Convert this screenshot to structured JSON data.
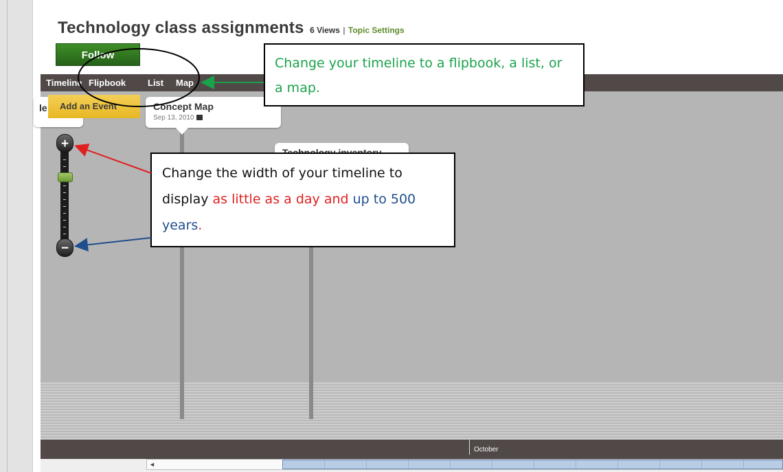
{
  "page": {
    "title": "Technology class assignments",
    "views": "6 Views",
    "separator": "|",
    "topic_settings": "Topic Settings",
    "follow_label": "Follow"
  },
  "nav": {
    "tabs": [
      {
        "label": "Timeline"
      },
      {
        "label": "Flipbook"
      },
      {
        "label": "List"
      },
      {
        "label": "Map"
      }
    ]
  },
  "timeline": {
    "add_event_label": "Add an Event",
    "cut_card_fragment": "le",
    "cards": [
      {
        "title": "Concept Map",
        "date": "Sep 13, 2010"
      },
      {
        "title": "Technology inventory",
        "date": ""
      }
    ],
    "month_label": "October",
    "zoom": {
      "in_symbol": "+",
      "out_symbol": "−",
      "level": 0.27
    }
  },
  "callouts": {
    "view_modes": {
      "text": "Change your timeline to a flipbook, a list, or a map.",
      "color": "#1aa34a"
    },
    "width": {
      "part1": "Change the width of your timeline to display",
      "part2_red": "as little as a day and",
      "part3_blue": "up to 500 years",
      "part4_red": ".",
      "colors": {
        "red": "#e02020",
        "blue": "#1f4e8c"
      }
    }
  },
  "icons": [
    "zoom-in-icon",
    "zoom-out-icon",
    "calendar-icon",
    "scroll-left-arrow-icon"
  ]
}
